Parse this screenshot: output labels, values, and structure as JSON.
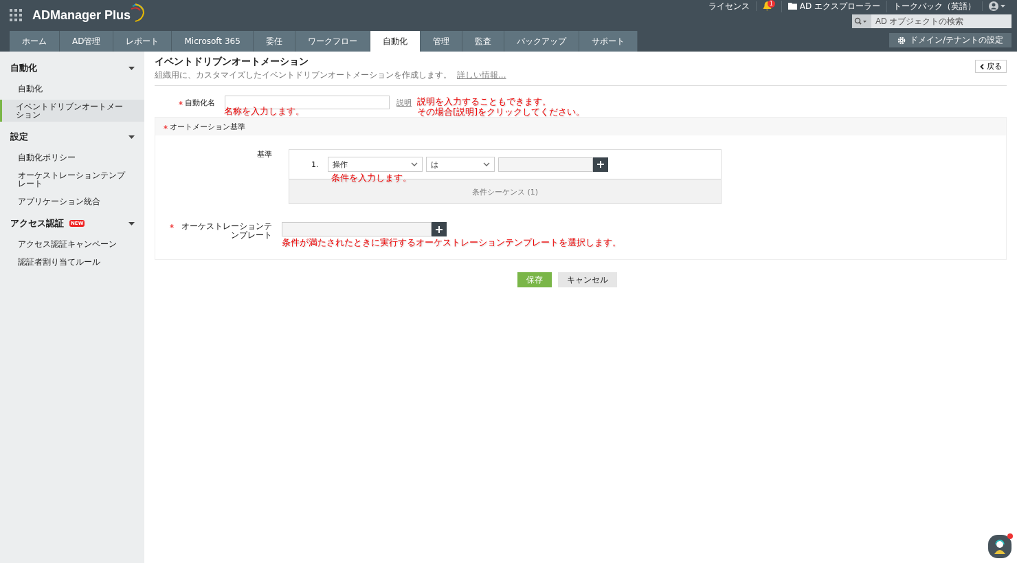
{
  "header": {
    "logo": "ADManager Plus",
    "top_links": [
      {
        "kind": "text",
        "label": "ライセンス"
      },
      {
        "kind": "bell",
        "badge": "1"
      },
      {
        "kind": "folder",
        "label": "AD エクスプローラー"
      },
      {
        "kind": "text",
        "label": "トークバック（英語）"
      },
      {
        "kind": "user"
      }
    ],
    "search": {
      "placeholder": "AD オブジェクトの検索"
    },
    "tabs": [
      {
        "label": "ホーム",
        "selected": false
      },
      {
        "label": "AD管理",
        "selected": false
      },
      {
        "label": "レポート",
        "selected": false
      },
      {
        "label": "Microsoft 365",
        "selected": false
      },
      {
        "label": "委任",
        "selected": false
      },
      {
        "label": "ワークフロー",
        "selected": false
      },
      {
        "label": "自動化",
        "selected": true
      },
      {
        "label": "管理",
        "selected": false
      },
      {
        "label": "監査",
        "selected": false
      },
      {
        "label": "バックアップ",
        "selected": false
      },
      {
        "label": "サポート",
        "selected": false
      }
    ],
    "domain_button": "ドメイン/テナントの設定"
  },
  "sidebar": {
    "sections": [
      {
        "title": "自動化",
        "expanded": true,
        "items": [
          {
            "label": "自動化",
            "selected": false
          },
          {
            "label": "イベントドリブンオートメーション",
            "selected": true
          }
        ]
      },
      {
        "title": "設定",
        "expanded": true,
        "items": [
          {
            "label": "自動化ポリシー",
            "selected": false
          },
          {
            "label": "オーケストレーションテンプレート",
            "selected": false
          },
          {
            "label": "アプリケーション統合",
            "selected": false
          }
        ]
      },
      {
        "title": "アクセス認証",
        "badge": "NEW",
        "expanded": true,
        "items": [
          {
            "label": "アクセス認証キャンペーン",
            "selected": false
          },
          {
            "label": "認証者割り当てルール",
            "selected": false
          }
        ]
      }
    ]
  },
  "page": {
    "title": "イベントドリブンオートメーション",
    "subtitle": "組織用に、カスタマイズしたイベントドリブンオートメーションを作成します。",
    "more_link": "詳しい情報...",
    "back_button": "戻る"
  },
  "form": {
    "name": {
      "label": "自動化名",
      "required": true,
      "description_link": "説明",
      "note": "名称を入力します。",
      "description_note": [
        "説明を入力することもできます。",
        "その場合[説明]をクリックしてください。"
      ]
    },
    "criteria_section": {
      "title": "オートメーション基準",
      "required": true,
      "label": "基準",
      "conditions": [
        {
          "number": "1.",
          "field": "操作",
          "operator": "は"
        }
      ],
      "note": "条件を入力します。",
      "sequence": "条件シーケンス (1)"
    },
    "template": {
      "label": "オーケストレーションテンプレート",
      "required": true,
      "note": "条件が満たされたときに実行するオーケストレーションテンプレートを選択します。"
    },
    "buttons": [
      {
        "kind": "primary",
        "label": "保存"
      },
      {
        "kind": "secondary",
        "label": "キャンセル"
      }
    ]
  },
  "chat_widget": {
    "unread": true
  }
}
